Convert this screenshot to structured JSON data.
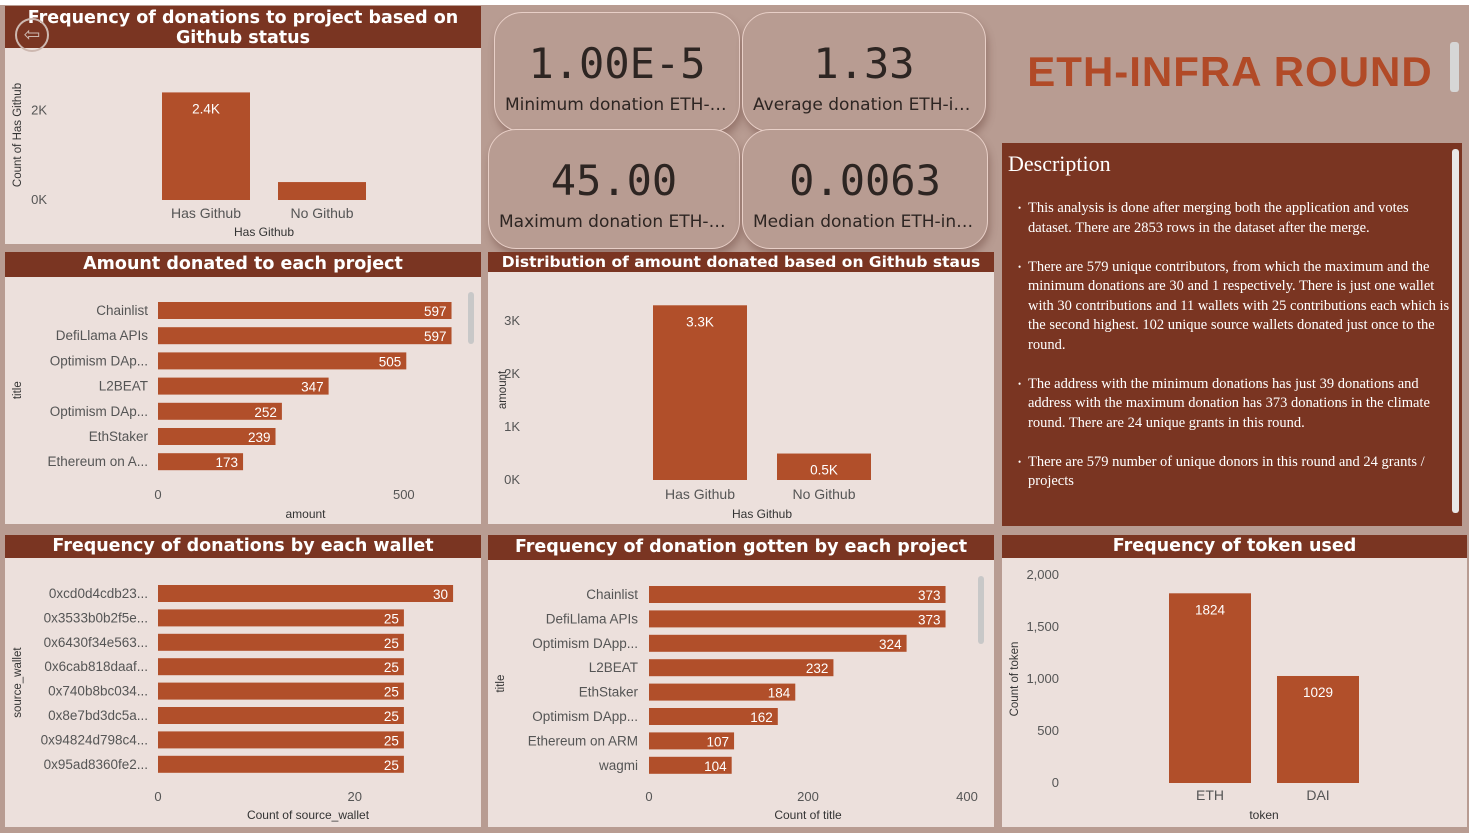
{
  "report": {
    "round_title": "ETH-INFRA ROUND"
  },
  "cards": [
    {
      "value": "1.00E-5",
      "label": "Minimum donation ETH-infra"
    },
    {
      "value": "1.33",
      "label": "Average donation ETH-infra"
    },
    {
      "value": "45.00",
      "label": "Maximum donation ETH-infra"
    },
    {
      "value": "0.0063",
      "label": "Median donation ETH-infra"
    }
  ],
  "description": {
    "heading": "Description",
    "paragraphs": [
      "This analysis is done after merging both the application and votes dataset. There are 2853 rows in the dataset after the merge.",
      "There are 579 unique contributors, from which the maximum and the minimum donations are 30 and 1 respectively. There is just one wallet with 30 contributions and 11 wallets with 25 contributions each which is the second highest. 102 unique source wallets donated just once to the round.",
      "The address with the minimum donations has just 39 donations and address with the maximum donation has 373 donations in the climate round. There are 24 unique grants in this round.",
      "There are 579 number of unique donors in this round and 24 grants / projects"
    ]
  },
  "colors": {
    "bar": "#b14f2a",
    "title_bg": "#7a3522",
    "panel_bg": "#ece0dc",
    "canvas_bg": "#b89c92"
  },
  "chart_data": [
    {
      "id": "github-freq",
      "type": "bar",
      "title": "Frequency of donations to project based on Github status",
      "categories": [
        "Has Github",
        "No Github"
      ],
      "values": [
        2400,
        400
      ],
      "data_labels": [
        "2.4K",
        ""
      ],
      "ticks": [
        0,
        2000
      ],
      "tick_labels": [
        "0K",
        "2K"
      ],
      "ylim": [
        0,
        2900
      ],
      "xlabel": "Has Github",
      "ylabel": "Count of Has Github"
    },
    {
      "id": "amount-by-project",
      "type": "bar",
      "orientation": "horizontal",
      "title": "Amount donated to each project",
      "categories": [
        "Chainlist",
        "DefiLlama APIs",
        "Optimism DAp...",
        "L2BEAT",
        "Optimism DAp...",
        "EthStaker",
        "Ethereum on A..."
      ],
      "values": [
        597,
        597,
        505,
        347,
        252,
        239,
        173
      ],
      "ticks": [
        0,
        500
      ],
      "xlim": [
        0,
        600
      ],
      "xlabel": "amount",
      "ylabel": "title"
    },
    {
      "id": "amount-by-github",
      "type": "bar",
      "title": "Distribution of amount donated based on Github staus",
      "categories": [
        "Has Github",
        "No Github"
      ],
      "values": [
        3300,
        500
      ],
      "data_labels": [
        "3.3K",
        "0.5K"
      ],
      "ticks": [
        0,
        1000,
        2000,
        3000
      ],
      "tick_labels": [
        "0K",
        "1K",
        "2K",
        "3K"
      ],
      "ylim": [
        0,
        3400
      ],
      "xlabel": "Has Github",
      "ylabel": "amount"
    },
    {
      "id": "wallet-freq",
      "type": "bar",
      "orientation": "horizontal",
      "title": "Frequency of donations by each wallet",
      "categories": [
        "0xcd0d4cdb23...",
        "0x3533b0b2f5e...",
        "0x6430f34e563...",
        "0x6cab818daaf...",
        "0x740b8bc034...",
        "0x8e7bd3dc5a...",
        "0x94824d798c4...",
        "0x95ad8360fe2..."
      ],
      "values": [
        30,
        25,
        25,
        25,
        25,
        25,
        25,
        25
      ],
      "ticks": [
        0,
        20
      ],
      "xlim": [
        0,
        30.5
      ],
      "xlabel": "Count of source_wallet",
      "ylabel": "source_wallet"
    },
    {
      "id": "project-freq",
      "type": "bar",
      "orientation": "horizontal",
      "title": "Frequency of donation gotten by each project",
      "categories": [
        "Chainlist",
        "DefiLlama APIs",
        "Optimism DApp...",
        "L2BEAT",
        "EthStaker",
        "Optimism DApp...",
        "Ethereum on ARM",
        "wagmi"
      ],
      "values": [
        373,
        373,
        324,
        232,
        184,
        162,
        107,
        104
      ],
      "ticks": [
        0,
        200,
        400
      ],
      "xlim": [
        0,
        400
      ],
      "xlabel": "Count of title",
      "ylabel": "title"
    },
    {
      "id": "token-freq",
      "type": "bar",
      "title": "Frequency of token used",
      "categories": [
        "ETH",
        "DAI"
      ],
      "values": [
        1824,
        1029
      ],
      "data_labels": [
        "1824",
        "1029"
      ],
      "ticks": [
        0,
        500,
        1000,
        1500,
        2000
      ],
      "tick_labels": [
        "0",
        "500",
        "1,000",
        "1,500",
        "2,000"
      ],
      "ylim": [
        0,
        2000
      ],
      "xlabel": "token",
      "ylabel": "Count of token"
    }
  ]
}
